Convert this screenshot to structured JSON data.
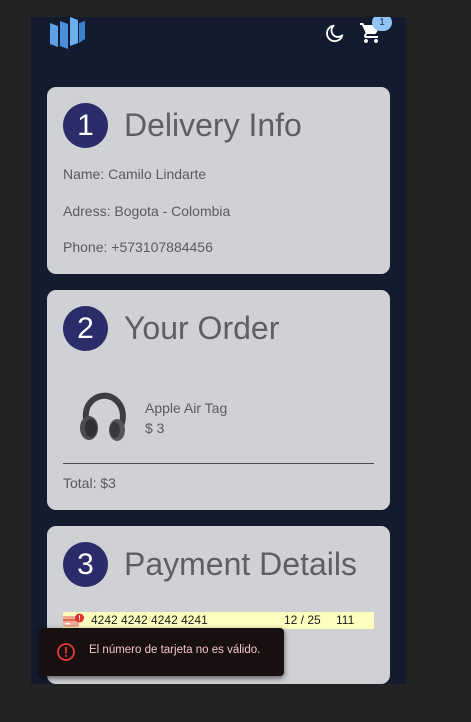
{
  "header": {
    "logo_icon": "brand-logo",
    "theme_icon": "moon-icon",
    "cart_icon": "cart-icon",
    "cart_count": "1",
    "accent_color": "#90c6f5",
    "background_color": "#131b2e"
  },
  "delivery": {
    "step": "1",
    "title": "Delivery Info",
    "name": "Name: Camilo Lindarte",
    "address": "Adress: Bogota - Colombia",
    "phone": "Phone: +573107884456"
  },
  "order": {
    "step": "2",
    "title": "Your Order",
    "items": [
      {
        "name": "Apple Air Tag",
        "price": "$ 3",
        "image_icon": "headphones-image"
      }
    ],
    "total": "Total: $3"
  },
  "payment": {
    "step": "3",
    "title": "Payment Details",
    "card_number": "4242 4242 4242 4241",
    "expiry": "12 / 25",
    "cvc": "111",
    "field_background": "#fdffbf",
    "brand_icon": "card-error-icon"
  },
  "toast": {
    "icon": "error-circle-icon",
    "message": "El número de tarjeta no es válido.",
    "text_color": "#f4c7c7",
    "icon_color": "#e53935"
  },
  "colors": {
    "card_background": "#d0d1d5",
    "step_circle": "#2a2d6a",
    "page_background": "#232323"
  }
}
